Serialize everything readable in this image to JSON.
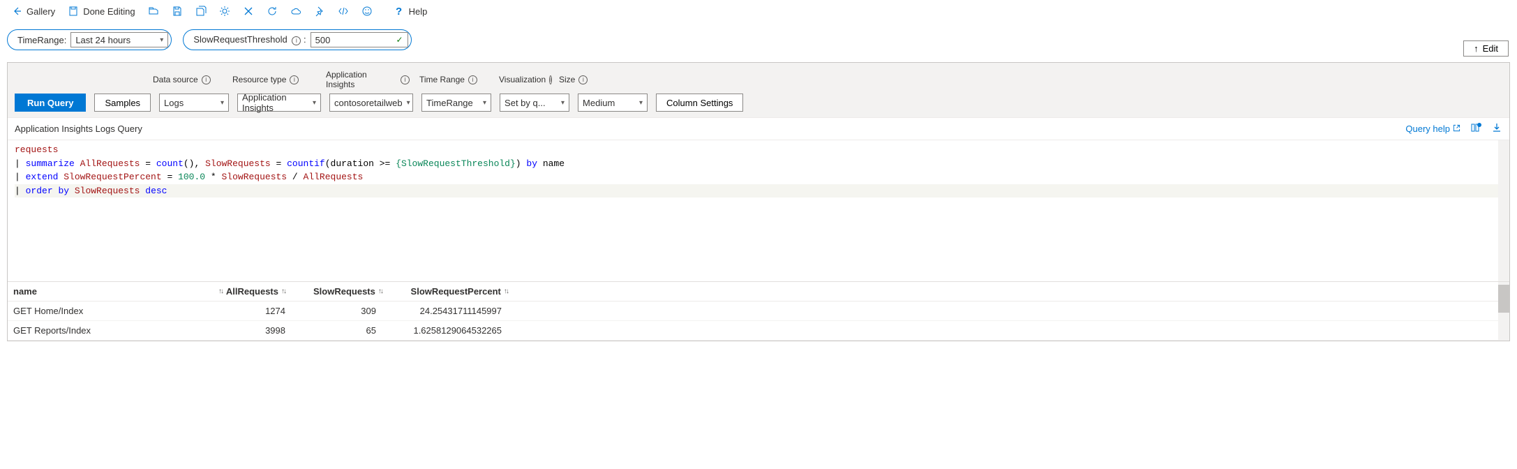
{
  "toolbar": {
    "gallery": "Gallery",
    "done_editing": "Done Editing",
    "help": "Help"
  },
  "params": {
    "time_range_label": "TimeRange:",
    "time_range_value": "Last 24 hours",
    "slow_threshold_label": "SlowRequestThreshold",
    "slow_threshold_colon": ":",
    "slow_threshold_value": "500"
  },
  "edit_button": "Edit",
  "query_panel": {
    "labels": {
      "data_source": "Data source",
      "resource_type": "Resource type",
      "app_insights": "Application Insights",
      "time_range": "Time Range",
      "visualization": "Visualization",
      "size": "Size"
    },
    "run_query": "Run Query",
    "samples": "Samples",
    "data_source_value": "Logs",
    "resource_type_value": "Application Insights",
    "app_insights_value": "contosoretailweb",
    "time_range_value": "TimeRange",
    "visualization_value": "Set by q...",
    "size_value": "Medium",
    "column_settings": "Column Settings",
    "title": "Application Insights Logs Query",
    "query_help": "Query help"
  },
  "code": {
    "line1_a": "requests",
    "line2_pre": "| ",
    "line2_kw": "summarize",
    "line2_a": " AllRequests ",
    "line2_eq1": "= ",
    "line2_fn1": "count",
    "line2_par1": "(), ",
    "line2_b": "SlowRequests ",
    "line2_eq2": "= ",
    "line2_fn2": "countif",
    "line2_par2a": "(duration >= ",
    "line2_param": "{SlowRequestThreshold}",
    "line2_par2b": ") ",
    "line2_by": "by",
    "line2_name": " name",
    "line3_pre": "| ",
    "line3_kw": "extend",
    "line3_a": " SlowRequestPercent ",
    "line3_eq": "= ",
    "line3_num": "100.0",
    "line3_op": " * ",
    "line3_b": "SlowRequests ",
    "line3_div": "/ ",
    "line3_c": "AllRequests",
    "line4_pre": "| ",
    "line4_kw1": "order",
    "line4_sp": " ",
    "line4_kw2": "by",
    "line4_a": " SlowRequests ",
    "line4_kw3": "desc"
  },
  "results": {
    "headers": {
      "name": "name",
      "all": "AllRequests",
      "slow": "SlowRequests",
      "pct": "SlowRequestPercent"
    },
    "rows": [
      {
        "name": "GET Home/Index",
        "all": "1274",
        "slow": "309",
        "pct": "24.25431711145997"
      },
      {
        "name": "GET Reports/Index",
        "all": "3998",
        "slow": "65",
        "pct": "1.6258129064532265"
      }
    ]
  }
}
